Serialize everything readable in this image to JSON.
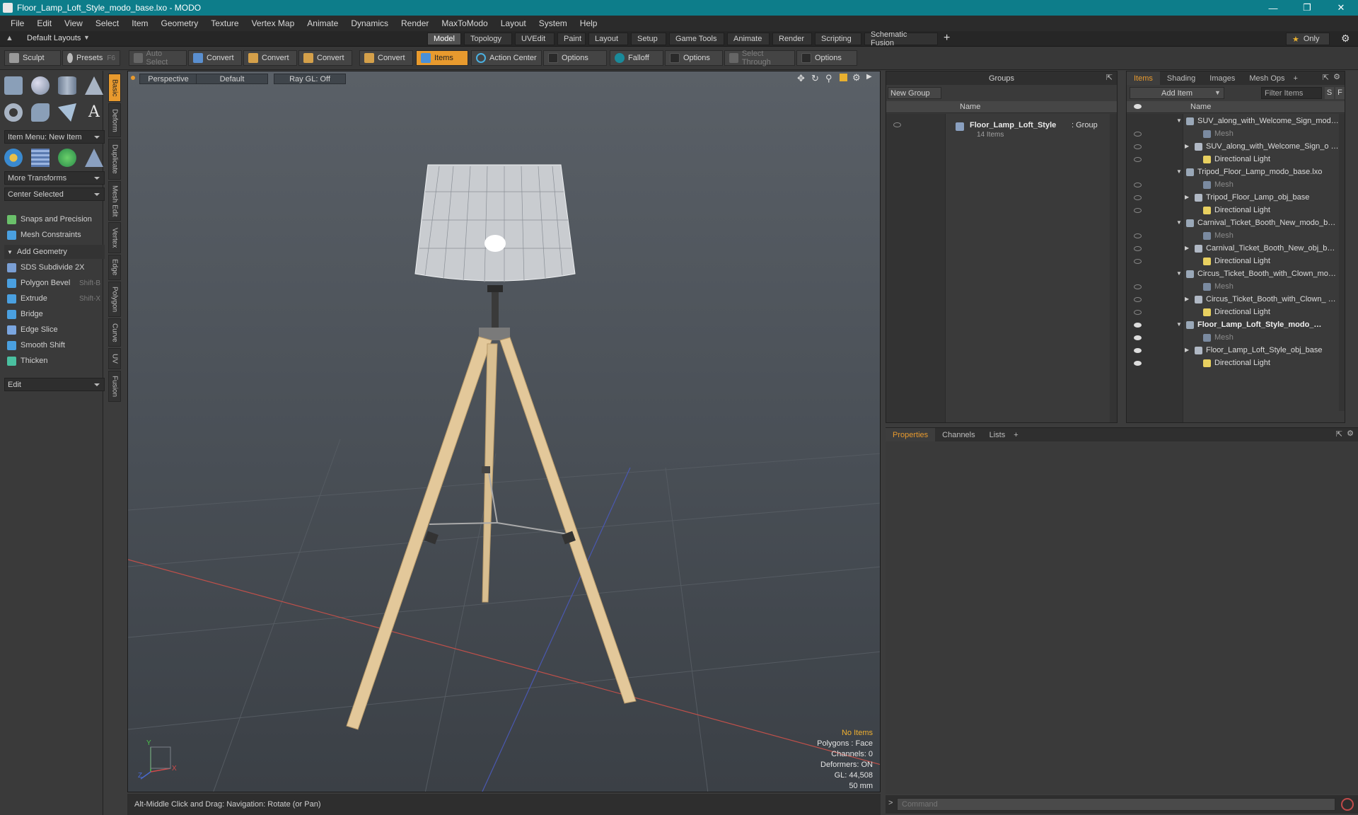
{
  "window": {
    "title": "Floor_Lamp_Loft_Style_modo_base.lxo - MODO"
  },
  "menu": [
    "File",
    "Edit",
    "View",
    "Select",
    "Item",
    "Geometry",
    "Texture",
    "Vertex Map",
    "Animate",
    "Dynamics",
    "Render",
    "MaxToModo",
    "Layout",
    "System",
    "Help"
  ],
  "layoutbar": {
    "layouts_label": "Default Layouts",
    "tabs": [
      "Model",
      "Topology",
      "UVEdit",
      "Paint",
      "Layout",
      "Setup",
      "Game Tools",
      "Animate",
      "Render",
      "Scripting",
      "Schematic Fusion"
    ],
    "active_tab": "Model",
    "only_label": "Only"
  },
  "toolbar": {
    "sculpt": "Sculpt",
    "presets": "Presets",
    "presets_key": "F6",
    "auto_select": "Auto Select",
    "convert1": "Convert",
    "convert2": "Convert",
    "convert3": "Convert",
    "convert4": "Convert",
    "items": "Items",
    "action_center": "Action Center",
    "options1": "Options",
    "falloff": "Falloff",
    "options2": "Options",
    "select_through": "Select Through",
    "options3": "Options"
  },
  "lefttools": {
    "item_menu": "Item Menu: New Item",
    "more_transforms": "More Transforms",
    "center_selected": "Center Selected",
    "snaps": "Snaps and Precision",
    "mesh_constraints": "Mesh Constraints",
    "add_geometry": "Add Geometry",
    "tools": [
      {
        "label": "SDS Subdivide 2X",
        "shortcut": "",
        "color": "#7a9fd4"
      },
      {
        "label": "Polygon Bevel",
        "shortcut": "Shift-B",
        "color": "#4aa0e0"
      },
      {
        "label": "Extrude",
        "shortcut": "Shift-X",
        "color": "#4aa0e0"
      },
      {
        "label": "Bridge",
        "shortcut": "",
        "color": "#4aa0e0"
      },
      {
        "label": "Edge Slice",
        "shortcut": "",
        "color": "#7aa6e0"
      },
      {
        "label": "Smooth Shift",
        "shortcut": "",
        "color": "#4aa0e0"
      },
      {
        "label": "Thicken",
        "shortcut": "",
        "color": "#4ac0a0"
      }
    ],
    "edit_dropdown": "Edit"
  },
  "vtabs": [
    "Basic",
    "Deform",
    "Duplicate",
    "Mesh Edit",
    "Vertex",
    "Edge",
    "Polygon",
    "Curve",
    "UV",
    "Fusion"
  ],
  "viewport": {
    "view": "Perspective",
    "shading": "Default",
    "raygl": "Ray GL: Off",
    "info": {
      "no_items": "No Items",
      "polygons": "Polygons : Face",
      "channels": "Channels: 0",
      "deformers": "Deformers: ON",
      "gl": "GL: 44,508",
      "focal": "50 mm"
    },
    "axis": {
      "y": "Y",
      "x": "X",
      "z": "Z"
    }
  },
  "statusbar": {
    "hint": "Alt-Middle Click and Drag:   Navigation: Rotate (or Pan)"
  },
  "groups": {
    "title": "Groups",
    "new_group": "New Group",
    "col_name": "Name",
    "group_name": "Floor_Lamp_Loft_Style",
    "group_type": ": Group",
    "group_count": "14 Items"
  },
  "items": {
    "tabs": [
      "Items",
      "Shading",
      "Images",
      "Mesh Ops"
    ],
    "active_tab": "Items",
    "add_item": "Add Item",
    "filter": "Filter Items",
    "s_btn": "S",
    "f_btn": "F",
    "col_name": "Name",
    "rows": [
      {
        "label": "SUV_along_with_Welcome_Sign_mod…",
        "indent": 0,
        "kind": "scene",
        "bold": false,
        "eye": "none"
      },
      {
        "label": "Mesh",
        "indent": 2,
        "kind": "mesh",
        "bold": false,
        "eye": "off"
      },
      {
        "label": "SUV_along_with_Welcome_Sign_o …",
        "indent": 1,
        "kind": "obj",
        "bold": false,
        "eye": "off"
      },
      {
        "label": "Directional Light",
        "indent": 2,
        "kind": "light",
        "bold": false,
        "eye": "off"
      },
      {
        "label": "Tripod_Floor_Lamp_modo_base.lxo",
        "indent": 0,
        "kind": "scene",
        "bold": false,
        "eye": "none"
      },
      {
        "label": "Mesh",
        "indent": 2,
        "kind": "mesh",
        "bold": false,
        "eye": "off"
      },
      {
        "label": "Tripod_Floor_Lamp_obj_base",
        "indent": 1,
        "kind": "obj",
        "bold": false,
        "eye": "off"
      },
      {
        "label": "Directional Light",
        "indent": 2,
        "kind": "light",
        "bold": false,
        "eye": "off"
      },
      {
        "label": "Carnival_Ticket_Booth_New_modo_b…",
        "indent": 0,
        "kind": "scene",
        "bold": false,
        "eye": "none"
      },
      {
        "label": "Mesh",
        "indent": 2,
        "kind": "mesh",
        "bold": false,
        "eye": "off"
      },
      {
        "label": "Carnival_Ticket_Booth_New_obj_b…",
        "indent": 1,
        "kind": "obj",
        "bold": false,
        "eye": "off"
      },
      {
        "label": "Directional Light",
        "indent": 2,
        "kind": "light",
        "bold": false,
        "eye": "off"
      },
      {
        "label": "Circus_Ticket_Booth_with_Clown_mo…",
        "indent": 0,
        "kind": "scene",
        "bold": false,
        "eye": "none"
      },
      {
        "label": "Mesh",
        "indent": 2,
        "kind": "mesh",
        "bold": false,
        "eye": "off"
      },
      {
        "label": "Circus_Ticket_Booth_with_Clown_ …",
        "indent": 1,
        "kind": "obj",
        "bold": false,
        "eye": "off"
      },
      {
        "label": "Directional Light",
        "indent": 2,
        "kind": "light",
        "bold": false,
        "eye": "off"
      },
      {
        "label": "Floor_Lamp_Loft_Style_modo_…",
        "indent": 0,
        "kind": "scene",
        "bold": true,
        "eye": "on"
      },
      {
        "label": "Mesh",
        "indent": 2,
        "kind": "mesh",
        "bold": false,
        "eye": "on"
      },
      {
        "label": "Floor_Lamp_Loft_Style_obj_base",
        "indent": 1,
        "kind": "obj",
        "bold": false,
        "eye": "on"
      },
      {
        "label": "Directional Light",
        "indent": 2,
        "kind": "light",
        "bold": false,
        "eye": "on"
      }
    ]
  },
  "props": {
    "tabs": [
      "Properties",
      "Channels",
      "Lists"
    ],
    "active_tab": "Properties"
  },
  "command": {
    "placeholder": "Command"
  },
  "colors": {
    "accent": "#e89a2e",
    "titlebar": "#0d7d8a"
  }
}
